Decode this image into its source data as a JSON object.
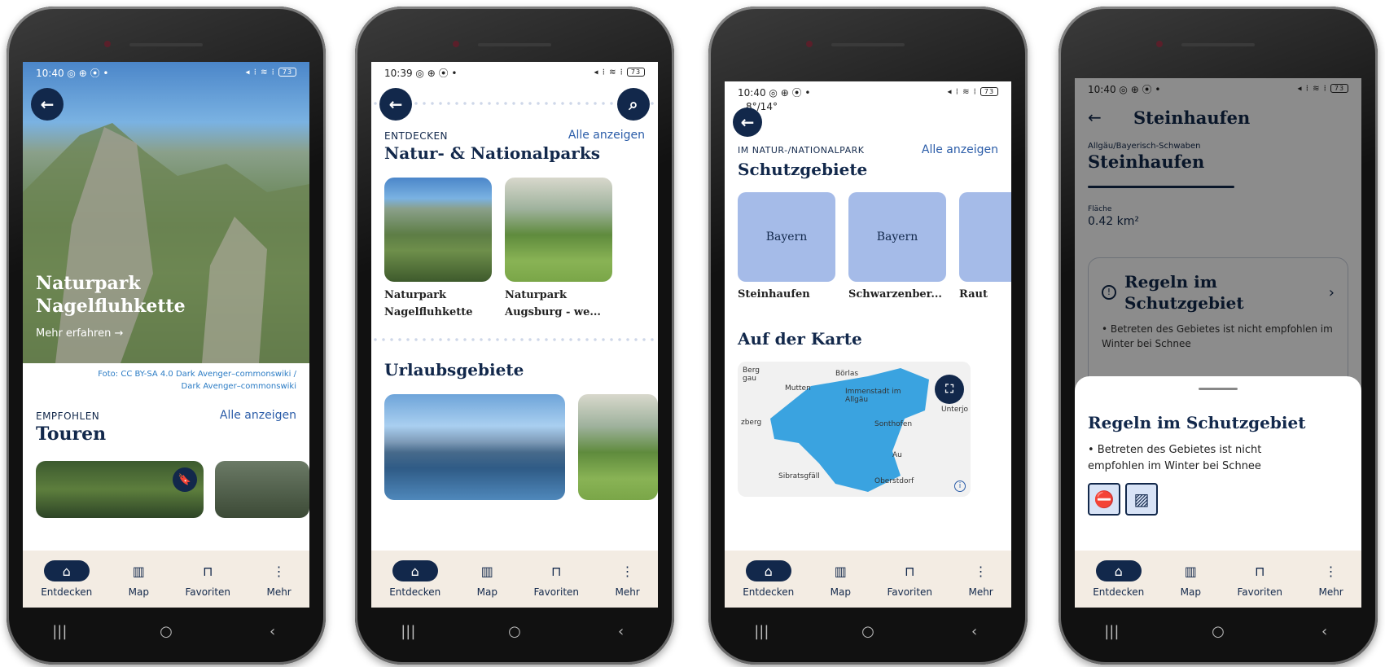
{
  "status": {
    "time_a": "10:40",
    "time_b": "10:39",
    "time_c": "10:40",
    "time_d": "10:40",
    "icons_left": "◎ ⊕ ⦿ •",
    "icons_right": "◂ ⁞ ≋ ⁞",
    "battery": "73"
  },
  "nav": {
    "entdecken": "Entdecken",
    "map": "Map",
    "favoriten": "Favoriten",
    "mehr": "Mehr"
  },
  "phone1": {
    "hero_title_1": "Naturpark",
    "hero_title_2": "Nagelfluhkette",
    "mehr_erfahren": "Mehr erfahren →",
    "credit_1": "Foto: CC BY-SA 4.0 Dark Avenger–commonswiki /",
    "credit_2": "Dark Avenger–commonswiki",
    "overline": "EMPFOHLEN",
    "alle": "Alle anzeigen",
    "heading": "Touren"
  },
  "phone2": {
    "overline": "ENTDECKEN",
    "alle": "Alle anzeigen",
    "heading": "Natur- & Nationalparks",
    "card1_l1": "Naturpark",
    "card1_l2": "Nagelfluhkette",
    "card2_l1": "Naturpark",
    "card2_l2": "Augsburg - we...",
    "heading2": "Urlaubsgebiete"
  },
  "phone3": {
    "temp": "8°/14°",
    "overline": "IM NATUR-/NATIONALPARK",
    "alle": "Alle anzeigen",
    "heading": "Schutzgebiete",
    "bayern": "Bayern",
    "card1": "Steinhaufen",
    "card2": "Schwarzenber...",
    "card3": "Raut",
    "heading2": "Auf der Karte",
    "map_labels": [
      "Berg gau",
      "Börlas",
      "Mutten",
      "Immenstadt im Allgäu",
      "Unterjo",
      "zberg",
      "Sonthofen",
      "Au",
      "Sibratsgfäll",
      "Oberstdorf"
    ]
  },
  "phone4": {
    "title": "Steinhaufen",
    "region": "Allgäu/Bayerisch-Schwaben",
    "name": "Steinhaufen",
    "flaeche_label": "Fläche",
    "flaeche_value": "0.42 km²",
    "rules_title_1": "Regeln im",
    "rules_title_2": "Schutzgebiet",
    "rules_text": "• Betreten des Gebietes ist nicht empfohlen im Winter bei Schnee",
    "sheet_title": "Regeln im Schutzgebiet",
    "sheet_text_1": "• Betreten des Gebietes ist nicht",
    "sheet_text_2": "empfohlen im Winter bei Schnee"
  }
}
